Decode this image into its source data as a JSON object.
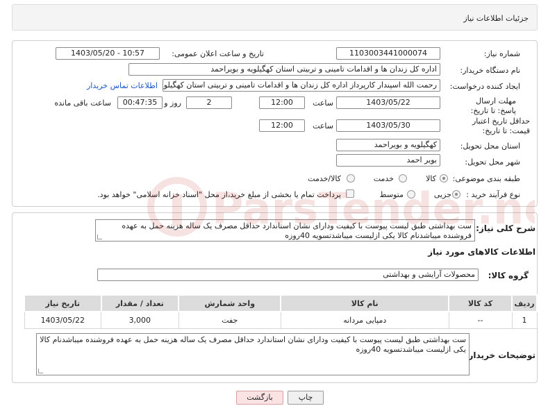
{
  "header": {
    "title": "جزئیات اطلاعات نیاز"
  },
  "form": {
    "need_number_label": "شماره نیاز:",
    "need_number": "1103003441000074",
    "announce_label": "تاریخ و ساعت اعلان عمومی:",
    "announce_value": "1403/05/20 - 10:57",
    "buyer_org_label": "نام دستگاه خریدار:",
    "buyer_org": "اداره کل زندان ها و اقدامات تامینی و تربیتی استان کهگیلویه و بویراحمد",
    "requester_label": "ایجاد کننده درخواست:",
    "requester": "رحمت الله اسپندار کارپرداز اداره کل زندان ها و اقدامات تامینی و تربیتی استان کهگیلویه و بویراحمد",
    "contact_link": "اطلاعات تماس خریدار",
    "reply_deadline_label": "مهلت ارسال پاسخ: تا تاریخ:",
    "reply_date": "1403/05/22",
    "time_label": "ساعت",
    "reply_time": "12:00",
    "days_value": "2",
    "days_label": "روز و",
    "remaining_time": "00:47:35",
    "remaining_label": "ساعت باقی مانده",
    "validity_label": "حداقل تاریخ اعتبار قیمت: تا تاریخ:",
    "validity_date": "1403/05/30",
    "validity_time": "12:00",
    "province_label": "استان محل تحویل:",
    "province": "کهگیلویه و بویراحمد",
    "city_label": "شهر محل تحویل:",
    "city": "بویر احمد",
    "category_label": "طبقه بندی موضوعی:",
    "category_options": [
      "کالا",
      "خدمت",
      "کالا/خدمت"
    ],
    "process_label": "نوع فرآیند خرید :",
    "process_options": [
      "جزیی",
      "متوسط"
    ],
    "payment_note": "پرداخت تمام یا بخشی از مبلغ خرید،از محل \"اسناد خزانه اسلامی\" خواهد بود."
  },
  "summary": {
    "label": "شرح کلی نیاز:",
    "text": "ست بهداشتی طبق لیست پیوست با کیفیت ودارای نشان استاندارد حداقل مصرف یک ساله هزینه حمل به عهده فروشنده میباشدنام کالا یکی ازلیست میباشدتسویه 40روزه"
  },
  "goods": {
    "section_title": "اطلاعات کالاهای مورد نیاز",
    "group_label": "گروه کالا:",
    "group_value": "محصولات آرایشی و بهداشتی",
    "columns": [
      "ردیف",
      "کد کالا",
      "نام کالا",
      "واحد شمارش",
      "تعداد / مقدار",
      "تاریخ نیاز"
    ],
    "rows": [
      {
        "index": "1",
        "code": "--",
        "name": "دمپایی مردانه",
        "unit": "جفت",
        "qty": "3,000",
        "date": "1403/05/22"
      }
    ],
    "buyer_notes_label": "توضیحات خریدار:",
    "buyer_notes": "ست بهداشتی طبق لیست پیوست با کیفیت ودارای نشان استاندارد حداقل مصرف یک ساله هزینه حمل به عهده فروشنده میباشدنام کالا یکی ازلیست میباشدتسویه 40روزه"
  },
  "buttons": {
    "print": "چاپ",
    "back": "بازگشت"
  },
  "watermark": {
    "text": "ParsTender.net",
    "color": "#c62828"
  }
}
